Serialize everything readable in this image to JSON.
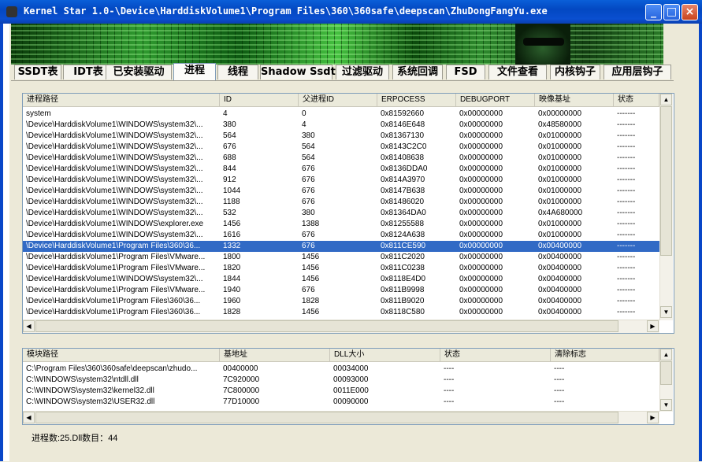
{
  "window": {
    "title": "Kernel Star 1.0-\\Device\\HarddiskVolume1\\Program Files\\360\\360safe\\deepscan\\ZhuDongFangYu.exe",
    "controls": [
      "_",
      "□",
      "×"
    ]
  },
  "tabs": [
    {
      "label": "SSDT表"
    },
    {
      "label": "IDT表"
    },
    {
      "label": "已安装驱动"
    },
    {
      "label": "进程",
      "active": true
    },
    {
      "label": "线程"
    },
    {
      "label": "Shadow Ssdt"
    },
    {
      "label": "过滤驱动"
    },
    {
      "label": "系统回调"
    },
    {
      "label": "FSD"
    },
    {
      "label": "文件查看"
    },
    {
      "label": "内核钩子"
    },
    {
      "label": "应用层钩子"
    }
  ],
  "process_table": {
    "columns": [
      "进程路径",
      "ID",
      "父进程ID",
      "ERPOCESS",
      "DEBUGPORT",
      "映像基址",
      "状态"
    ],
    "selected_index": 12,
    "rows": [
      [
        "system",
        "4",
        "0",
        "0x81592660",
        "0x00000000",
        "0x00000000",
        "-------"
      ],
      [
        "\\Device\\HarddiskVolume1\\WINDOWS\\system32\\...",
        "380",
        "4",
        "0x8146E648",
        "0x00000000",
        "0x48580000",
        "-------"
      ],
      [
        "\\Device\\HarddiskVolume1\\WINDOWS\\system32\\...",
        "564",
        "380",
        "0x81367130",
        "0x00000000",
        "0x01000000",
        "-------"
      ],
      [
        "\\Device\\HarddiskVolume1\\WINDOWS\\system32\\...",
        "676",
        "564",
        "0x8143C2C0",
        "0x00000000",
        "0x01000000",
        "-------"
      ],
      [
        "\\Device\\HarddiskVolume1\\WINDOWS\\system32\\...",
        "688",
        "564",
        "0x81408638",
        "0x00000000",
        "0x01000000",
        "-------"
      ],
      [
        "\\Device\\HarddiskVolume1\\WINDOWS\\system32\\...",
        "844",
        "676",
        "0x8136DDA0",
        "0x00000000",
        "0x01000000",
        "-------"
      ],
      [
        "\\Device\\HarddiskVolume1\\WINDOWS\\system32\\...",
        "912",
        "676",
        "0x814A3970",
        "0x00000000",
        "0x01000000",
        "-------"
      ],
      [
        "\\Device\\HarddiskVolume1\\WINDOWS\\system32\\...",
        "1044",
        "676",
        "0x8147B638",
        "0x00000000",
        "0x01000000",
        "-------"
      ],
      [
        "\\Device\\HarddiskVolume1\\WINDOWS\\system32\\...",
        "1188",
        "676",
        "0x81486020",
        "0x00000000",
        "0x01000000",
        "-------"
      ],
      [
        "\\Device\\HarddiskVolume1\\WINDOWS\\system32\\...",
        "532",
        "380",
        "0x81364DA0",
        "0x00000000",
        "0x4A680000",
        "-------"
      ],
      [
        "\\Device\\HarddiskVolume1\\WINDOWS\\explorer.exe",
        "1456",
        "1388",
        "0x81255588",
        "0x00000000",
        "0x01000000",
        "-------"
      ],
      [
        "\\Device\\HarddiskVolume1\\WINDOWS\\system32\\...",
        "1616",
        "676",
        "0x8124A638",
        "0x00000000",
        "0x01000000",
        "-------"
      ],
      [
        "\\Device\\HarddiskVolume1\\Program Files\\360\\36...",
        "1332",
        "676",
        "0x811CE590",
        "0x00000000",
        "0x00400000",
        "-------"
      ],
      [
        "\\Device\\HarddiskVolume1\\Program Files\\VMware...",
        "1800",
        "1456",
        "0x811C2020",
        "0x00000000",
        "0x00400000",
        "-------"
      ],
      [
        "\\Device\\HarddiskVolume1\\Program Files\\VMware...",
        "1820",
        "1456",
        "0x811C0238",
        "0x00000000",
        "0x00400000",
        "-------"
      ],
      [
        "\\Device\\HarddiskVolume1\\WINDOWS\\system32\\...",
        "1844",
        "1456",
        "0x8118E4D0",
        "0x00000000",
        "0x00400000",
        "-------"
      ],
      [
        "\\Device\\HarddiskVolume1\\Program Files\\VMware...",
        "1940",
        "676",
        "0x811B9998",
        "0x00000000",
        "0x00400000",
        "-------"
      ],
      [
        "\\Device\\HarddiskVolume1\\Program Files\\360\\36...",
        "1960",
        "1828",
        "0x811B9020",
        "0x00000000",
        "0x00400000",
        "-------"
      ],
      [
        "\\Device\\HarddiskVolume1\\Program Files\\360\\36...",
        "1828",
        "1456",
        "0x8118C580",
        "0x00000000",
        "0x00400000",
        "-------"
      ]
    ]
  },
  "module_table": {
    "columns": [
      "模块路径",
      "基地址",
      "DLL大小",
      "状态",
      "清除标志"
    ],
    "rows": [
      [
        "C:\\Program Files\\360\\360safe\\deepscan\\zhudo...",
        "00400000",
        "00034000",
        "----",
        "----"
      ],
      [
        "C:\\WINDOWS\\system32\\ntdll.dll",
        "7C920000",
        "00093000",
        "----",
        "----"
      ],
      [
        "C:\\WINDOWS\\system32\\kernel32.dll",
        "7C800000",
        "0011E000",
        "----",
        "----"
      ],
      [
        "C:\\WINDOWS\\system32\\USER32.dll",
        "77D10000",
        "00090000",
        "----",
        "----"
      ]
    ]
  },
  "status_text": "进程数:25.Dll数目：44",
  "colors": {
    "titlebar": "#0348c2",
    "selection": "#316ac5",
    "face": "#ece9d8"
  }
}
